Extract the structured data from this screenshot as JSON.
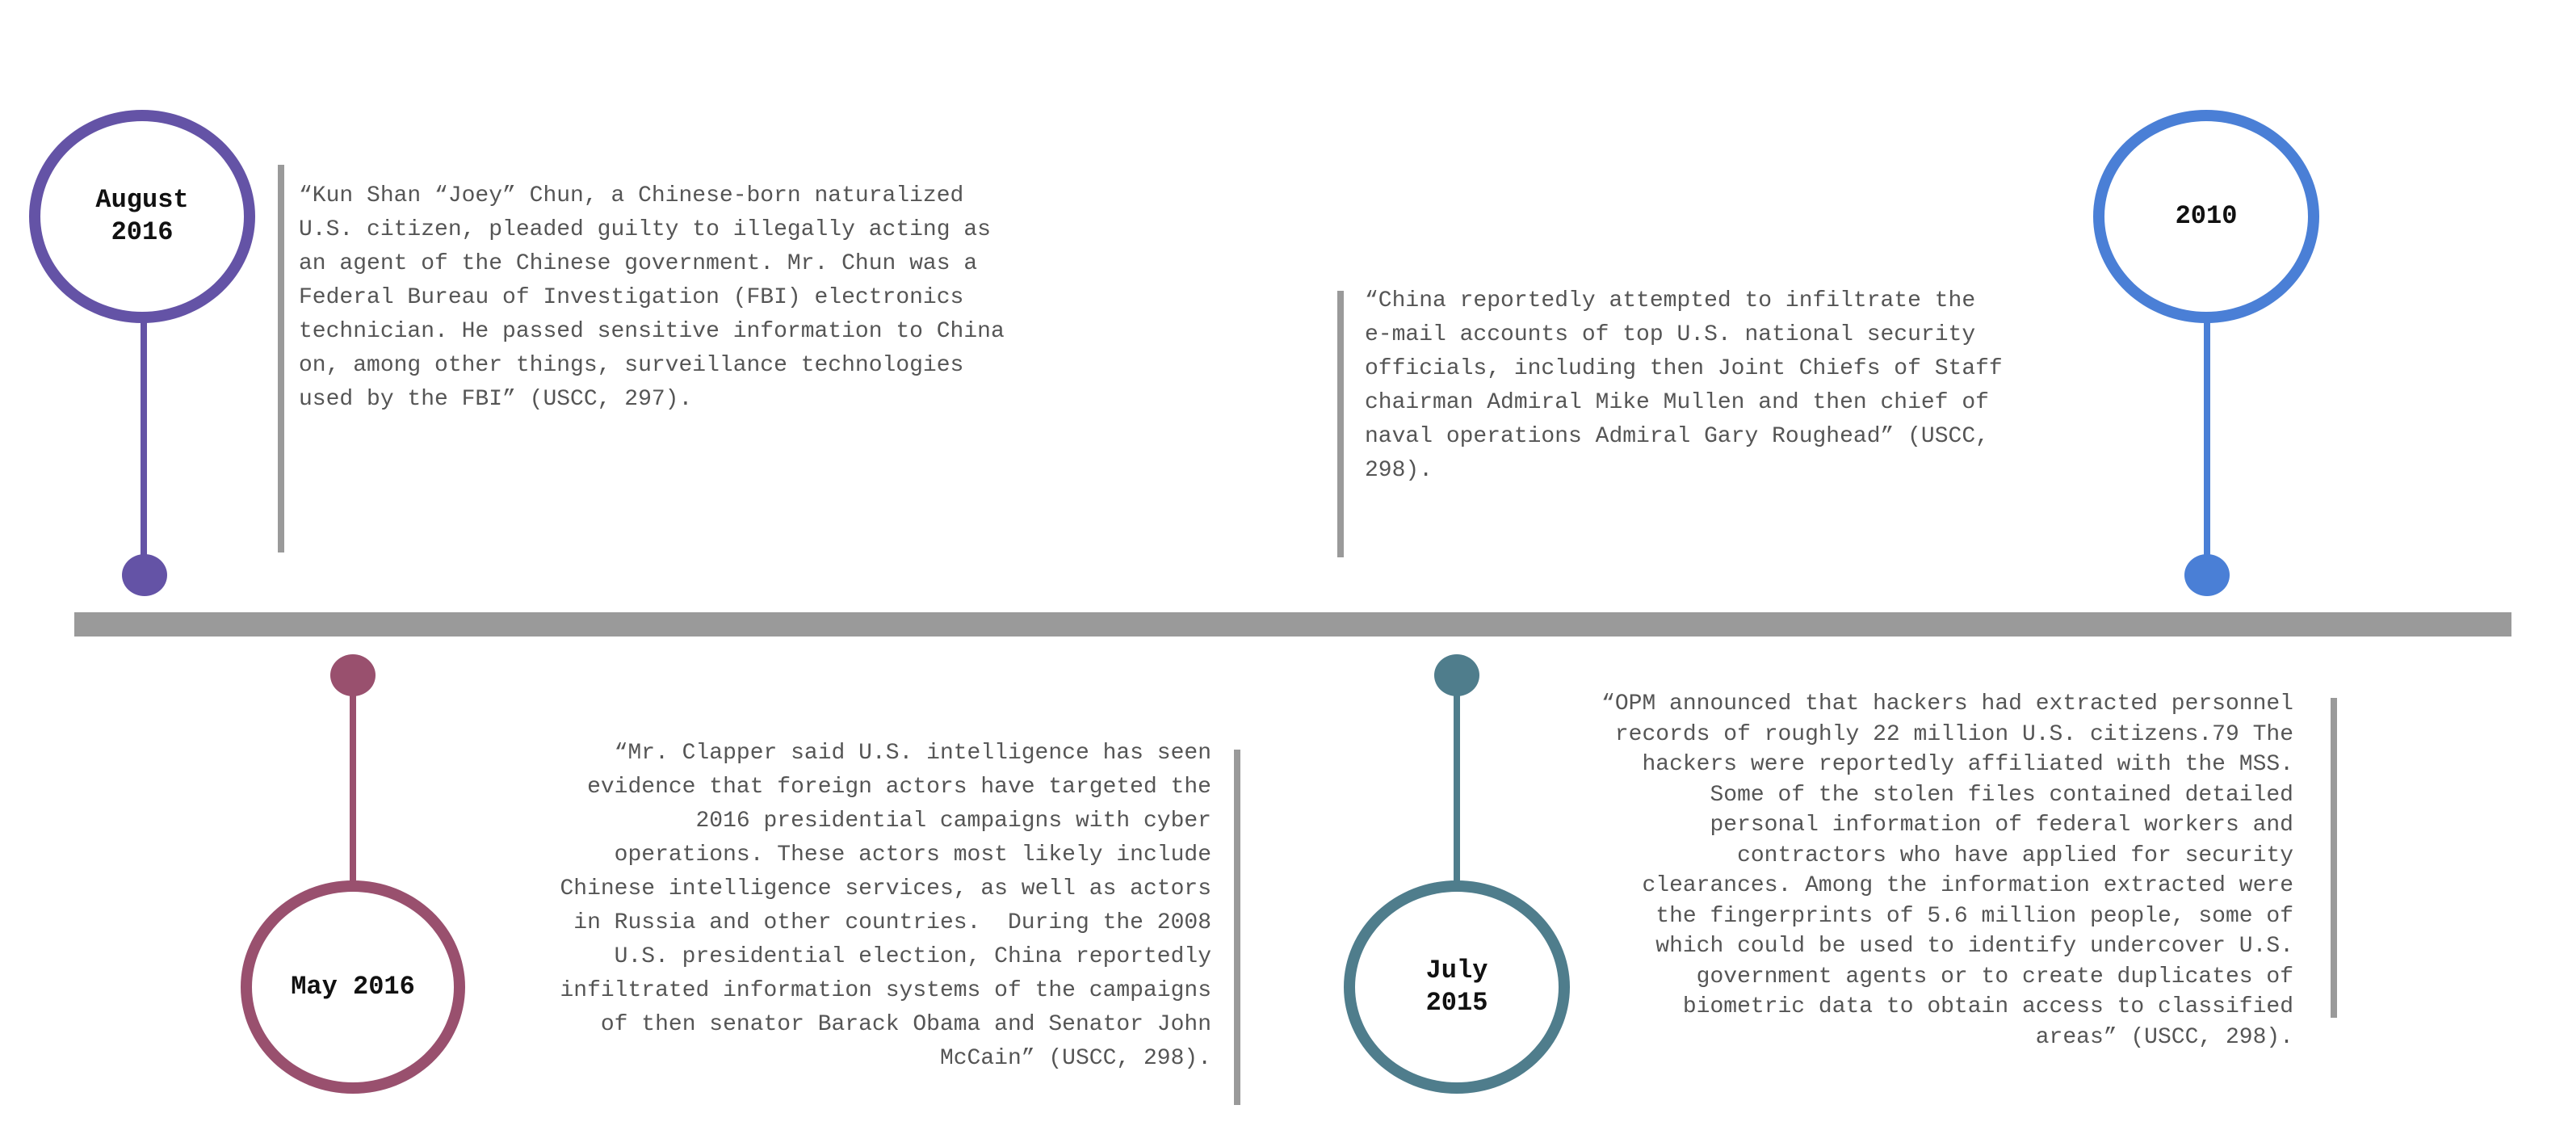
{
  "colors": {
    "axis": "#9a9a9a",
    "aug2016": "#6453a6",
    "y2010": "#4a7fd6",
    "may2016": "#99506e",
    "jul2015": "#4f7d8c",
    "text": "#555555"
  },
  "events": {
    "aug2016": {
      "date_lines": [
        "August",
        "2016"
      ],
      "quote_lines": [
        "“Kun Shan “Joey” Chun, a Chinese-born naturalized",
        "U.S. citizen, pleaded guilty to illegally acting as",
        "an agent of the Chinese government. Mr. Chun was a",
        "Federal Bureau of Investigation (FBI) electronics",
        "technician. He passed sensitive information to China",
        "on, among other things, surveillance technologies",
        "used by the FBI” (USCC, 297)."
      ]
    },
    "y2010": {
      "date_lines": [
        "2010"
      ],
      "quote_lines": [
        "“China reportedly attempted to infiltrate the",
        "e-mail accounts of top U.S. national security",
        "officials, including then Joint Chiefs of Staff",
        "chairman Admiral Mike Mullen and then chief of",
        "naval operations Admiral Gary Roughead” (USCC,",
        "298)."
      ]
    },
    "may2016": {
      "date_lines": [
        "May 2016"
      ],
      "quote_lines": [
        "“Mr. Clapper said U.S. intelligence has seen",
        "evidence that foreign actors have targeted the",
        "2016 presidential campaigns with cyber",
        "operations. These actors most likely include",
        "Chinese intelligence services, as well as actors",
        "in Russia and other countries.  During the 2008",
        "U.S. presidential election, China reportedly",
        "infiltrated information systems of the campaigns",
        "of then senator Barack Obama and Senator John",
        "McCain” (USCC, 298)."
      ]
    },
    "jul2015": {
      "date_lines": [
        "July",
        "2015"
      ],
      "quote_lines": [
        "“OPM announced that hackers had extracted personnel",
        "records of roughly 22 million U.S. citizens.79 The",
        "hackers were reportedly affiliated with the MSS.",
        "Some of the stolen files contained detailed",
        "personal information of federal workers and",
        "contractors who have applied for security",
        "clearances. Among the information extracted were",
        "the fingerprints of 5.6 million people, some of",
        "which could be used to identify undercover U.S.",
        "government agents or to create duplicates of",
        "biometric data to obtain access to classified",
        "areas” (USCC, 298)."
      ]
    }
  }
}
